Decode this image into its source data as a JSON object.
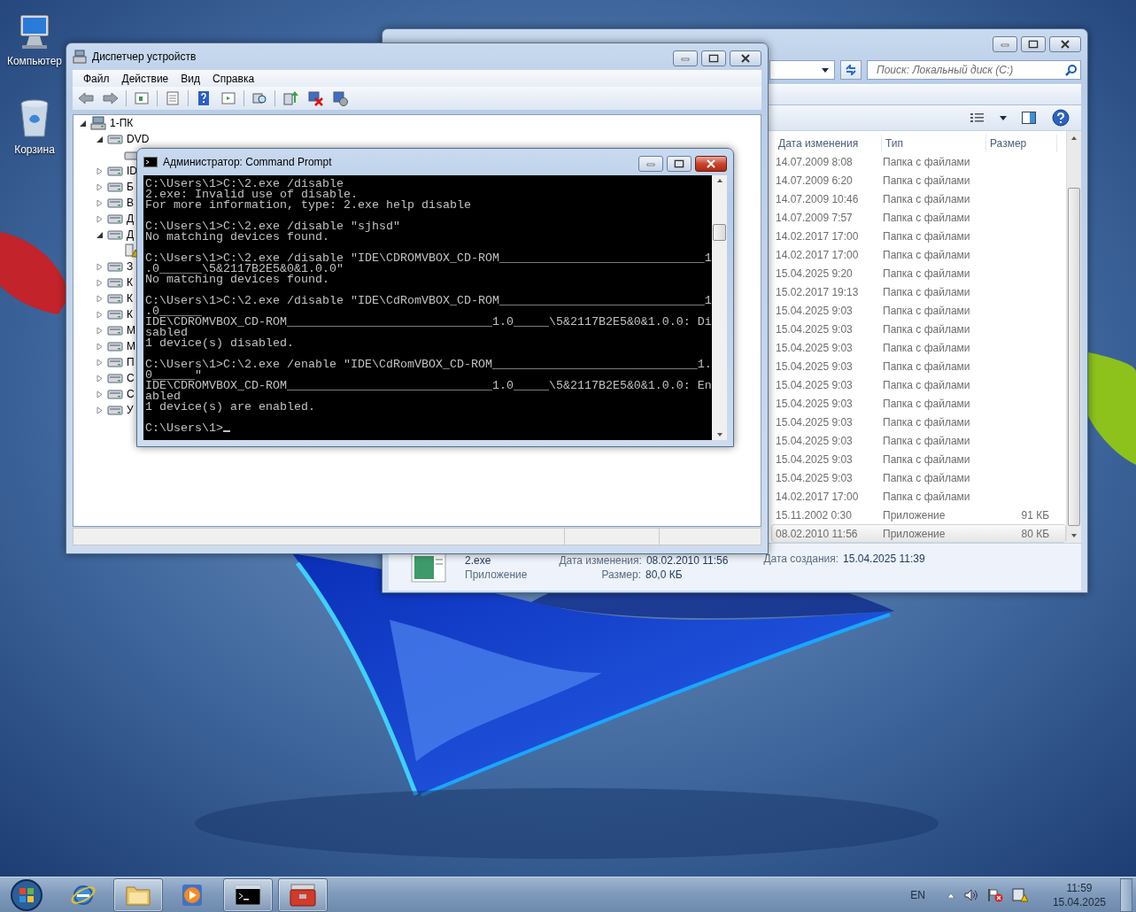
{
  "desktop": {
    "icons": [
      {
        "label": "Компьютер"
      },
      {
        "label": "Корзина"
      }
    ]
  },
  "explorer": {
    "active": false,
    "search": {
      "placeholder": "Поиск: Локальный диск (C:)"
    },
    "columns": [
      "Дата изменения",
      "Тип",
      "Размер"
    ],
    "rows": [
      {
        "date": "14.07.2009 8:08",
        "type": "Папка с файлами",
        "selected": false
      },
      {
        "date": "14.07.2009 6:20",
        "type": "Папка с файлами",
        "selected": false
      },
      {
        "date": "14.07.2009 10:46",
        "type": "Папка с файлами",
        "selected": false
      },
      {
        "date": "14.07.2009 7:57",
        "type": "Папка с файлами",
        "selected": false
      },
      {
        "date": "14.02.2017 17:00",
        "type": "Папка с файлами",
        "selected": false
      },
      {
        "date": "14.02.2017 17:00",
        "type": "Папка с файлами",
        "selected": false
      },
      {
        "date": "15.04.2025 9:20",
        "type": "Папка с файлами",
        "selected": false
      },
      {
        "date": "15.02.2017 19:13",
        "type": "Папка с файлами",
        "selected": false
      },
      {
        "date": "15.04.2025 9:03",
        "type": "Папка с файлами",
        "selected": false
      },
      {
        "date": "15.04.2025 9:03",
        "type": "Папка с файлами",
        "selected": false
      },
      {
        "date": "15.04.2025 9:03",
        "type": "Папка с файлами",
        "selected": false
      },
      {
        "date": "15.04.2025 9:03",
        "type": "Папка с файлами",
        "selected": false
      },
      {
        "date": "15.04.2025 9:03",
        "type": "Папка с файлами",
        "selected": false
      },
      {
        "date": "15.04.2025 9:03",
        "type": "Папка с файлами",
        "selected": false
      },
      {
        "date": "15.04.2025 9:03",
        "type": "Папка с файлами",
        "selected": false
      },
      {
        "date": "15.04.2025 9:03",
        "type": "Папка с файлами",
        "selected": false
      },
      {
        "date": "15.04.2025 9:03",
        "type": "Папка с файлами",
        "selected": false
      },
      {
        "date": "15.04.2025 9:03",
        "type": "Папка с файлами",
        "selected": false
      },
      {
        "date": "14.02.2017 17:00",
        "type": "Папка с файлами",
        "selected": false
      },
      {
        "date": "15.11.2002 0:30",
        "type": "Приложение",
        "size": "91 КБ",
        "selected": false
      },
      {
        "date": "08.02.2010 11:56",
        "type": "Приложение",
        "size": "80 КБ",
        "selected": true
      }
    ],
    "details": {
      "name": "2.exe",
      "type": "Приложение",
      "modified_label": "Дата изменения:",
      "modified": "08.02.2010 11:56",
      "size_label": "Размер:",
      "size": "80,0 КБ",
      "created_label": "Дата создания:",
      "created": "15.04.2025 11:39"
    }
  },
  "device_manager": {
    "active": false,
    "title": "Диспетчер устройств",
    "menu": [
      "Файл",
      "Действие",
      "Вид",
      "Справка"
    ],
    "tree": [
      {
        "kind": "computer",
        "label": "1-ПК",
        "expanded": true,
        "children": [
          {
            "kind": "category",
            "label": "DVD",
            "expanded": true,
            "children": [
              {
                "kind": "device"
              }
            ]
          },
          {
            "kind": "category",
            "label": "ID",
            "expanded": false
          },
          {
            "kind": "category",
            "label": "Б",
            "expanded": false
          },
          {
            "kind": "category",
            "label": "В",
            "expanded": false
          },
          {
            "kind": "category",
            "label": "Д",
            "expanded": false
          },
          {
            "kind": "category",
            "label": "Д",
            "expanded": true,
            "children": [
              {
                "kind": "warning-device"
              }
            ]
          },
          {
            "kind": "category",
            "label": "З",
            "expanded": false
          },
          {
            "kind": "category",
            "label": "К",
            "expanded": false
          },
          {
            "kind": "category",
            "label": "К",
            "expanded": false
          },
          {
            "kind": "category",
            "label": "К",
            "expanded": false
          },
          {
            "kind": "category",
            "label": "М",
            "expanded": false
          },
          {
            "kind": "category",
            "label": "М",
            "expanded": false
          },
          {
            "kind": "category",
            "label": "П",
            "expanded": false
          },
          {
            "kind": "category",
            "label": "С",
            "expanded": false
          },
          {
            "kind": "category",
            "label": "С",
            "expanded": false
          },
          {
            "kind": "category",
            "label": "У",
            "expanded": false
          }
        ]
      }
    ]
  },
  "command_prompt": {
    "active": true,
    "title": "Администратор: Command Prompt",
    "blocks": [
      [
        "C:\\Users\\1>C:\\2.exe /disable",
        "2.exe: Invalid use of disable.",
        "For more information, type: 2.exe help disable"
      ],
      [
        "C:\\Users\\1>C:\\2.exe /disable \"sjhsd\"",
        "No matching devices found."
      ],
      [
        "C:\\Users\\1>C:\\2.exe /disable \"IDE\\CDROMVBOX_CD-ROM_____________________________1",
        ".0______\\5&2117B2E5&0&1.0.0\"",
        "No matching devices found."
      ],
      [
        "C:\\Users\\1>C:\\2.exe /disable \"IDE\\CdRomVBOX_CD-ROM_____________________________1",
        ".0______",
        "IDE\\CDROMVBOX_CD-ROM_____________________________1.0_____\\5&2117B2E5&0&1.0.0: Di",
        "sabled",
        "1 device(s) disabled."
      ],
      [
        "C:\\Users\\1>C:\\2.exe /enable \"IDE\\CdRomVBOX_CD-ROM_____________________________1.",
        "0______\"",
        "IDE\\CDROMVBOX_CD-ROM_____________________________1.0_____\\5&2117B2E5&0&1.0.0: En",
        "abled",
        "1 device(s) are enabled."
      ],
      [
        "C:\\Users\\1>"
      ]
    ]
  },
  "taskbar": {
    "buttons": [
      {
        "open": false
      },
      {
        "open": true
      },
      {
        "open": false
      },
      {
        "open": true
      },
      {
        "open": true
      }
    ],
    "language": "EN",
    "time": "11:59",
    "date": "15.04.2025"
  }
}
